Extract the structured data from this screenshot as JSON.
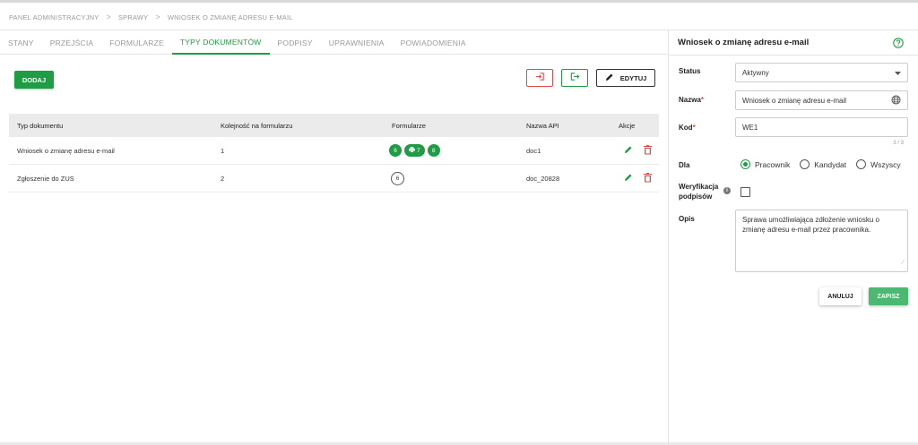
{
  "breadcrumb": {
    "items": [
      "PANEL ADMINISTRACYJNY",
      "SPRAWY",
      "WNIOSEK O ZMIANĘ ADRESU E-MAIL"
    ],
    "separator": ">"
  },
  "tabs": [
    {
      "label": "STANY",
      "active": false
    },
    {
      "label": "PRZEJŚCIA",
      "active": false
    },
    {
      "label": "FORMULARZE",
      "active": false
    },
    {
      "label": "TYPY DOKUMENTÓW",
      "active": true
    },
    {
      "label": "PODPISY",
      "active": false
    },
    {
      "label": "UPRAWNIENIA",
      "active": false
    },
    {
      "label": "POWIADOMIENIA",
      "active": false
    }
  ],
  "toolbar": {
    "add_label": "DODAJ",
    "import_icon": "import-icon",
    "export_icon": "export-icon",
    "edit_label": "EDYTUJ"
  },
  "table": {
    "headers": [
      "Typ dokumentu",
      "Kolejność na formularzu",
      "Formularze",
      "Nazwa API",
      "Akcje"
    ],
    "rows": [
      {
        "name": "Wniosek o zmianę adresu e-mail",
        "order": "1",
        "forms": [
          "6",
          "7",
          "8"
        ],
        "api": "doc1"
      },
      {
        "name": "Zgłoszenie do ZUS",
        "order": "2",
        "forms": [
          "6"
        ],
        "api": "doc_20828"
      }
    ]
  },
  "panel": {
    "title": "Wniosek o zmianę adresu e-mail",
    "status_label": "Status",
    "status_value": "Aktywny",
    "name_label": "Nazwa",
    "name_value": "Wniosek o zmianę adresu e-mail",
    "code_label": "Kod",
    "code_value": "WE1",
    "code_counter": "3 / 3",
    "for_label": "Dla",
    "for_options": [
      "Pracownik",
      "Kandydat",
      "Wszyscy"
    ],
    "for_selected": "Pracownik",
    "verification_label_1": "Weryfikacja",
    "verification_label_2": "podpisów",
    "description_label": "Opis",
    "description_value": "Sprawa umożliwiająca zdłożenie wniosku o zmianę adresu e-mail przez pracownika.",
    "cancel_label": "ANULUJ",
    "save_label": "ZAPISZ"
  },
  "colors": {
    "accent": "#1f9d45",
    "danger": "#e04a4a"
  }
}
